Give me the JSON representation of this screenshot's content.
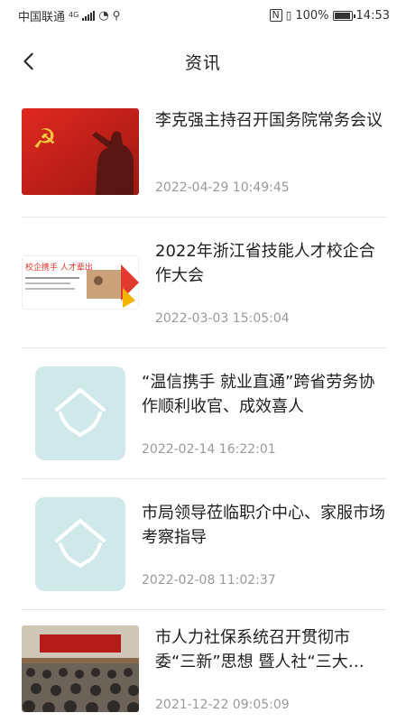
{
  "status_bar": {
    "carrier": "中国联通",
    "network": "4G",
    "battery": "100%",
    "battery_level": 1.0,
    "time": "14:53"
  },
  "header": {
    "title": "资讯",
    "back_icon": "chevron-left-icon"
  },
  "news": [
    {
      "title": "李克强主持召开国务院常务会议",
      "date": "2022-04-29 10:49:45",
      "thumb": "party-flag-photo"
    },
    {
      "title": "2022年浙江省技能人才校企合作大会",
      "date": "2022-03-03 15:05:04",
      "thumb": "banner-image",
      "thumb_text": "校企携手 人才辈出"
    },
    {
      "title": "“温信携手 就业直通”跨省劳务协作顺利收官、成效喜人",
      "date": "2022-02-14 16:22:01",
      "thumb": "placeholder-house-hands-icon"
    },
    {
      "title": "市局领导莅临职介中心、家服市场 考察指导",
      "date": "2022-02-08 11:02:37",
      "thumb": "placeholder-house-hands-icon"
    },
    {
      "title": "市人力社保系统召开贯彻市委“三新”思想 暨人社“三大…",
      "date": "2021-12-22 09:05:09",
      "thumb": "meeting-photo"
    }
  ],
  "colors": {
    "placeholder_bg": "#cfe9ea",
    "party_red": "#d9231d",
    "banner_red": "#e23a2e"
  }
}
